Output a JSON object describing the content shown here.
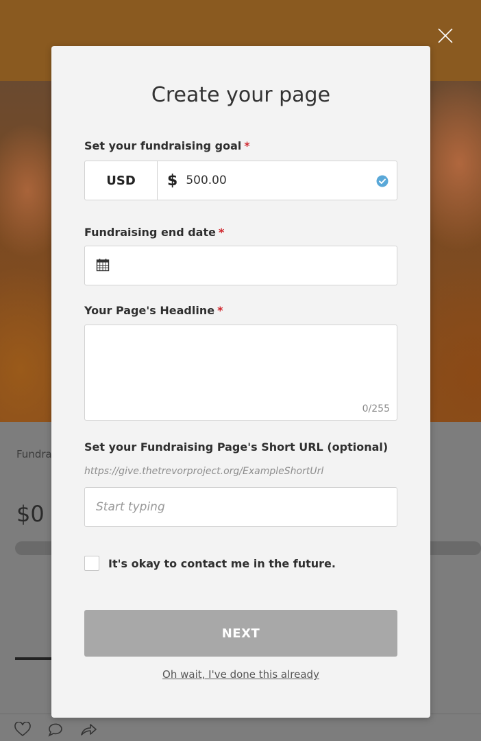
{
  "background": {
    "label": "Fundra",
    "amount": "$0"
  },
  "modal": {
    "title": "Create your page",
    "goal": {
      "label": "Set your fundraising goal",
      "required_mark": "*",
      "currency": "USD",
      "currency_symbol": "$",
      "amount": "500.00"
    },
    "end_date": {
      "label": "Fundraising end date",
      "required_mark": "*",
      "value": ""
    },
    "headline": {
      "label": "Your Page's Headline",
      "required_mark": "*",
      "value": "",
      "counter": "0/255"
    },
    "short_url": {
      "label": "Set your Fundraising Page's Short URL (optional)",
      "hint": "https://give.thetrevorproject.org/ExampleShortUrl",
      "placeholder": "Start typing"
    },
    "contact": {
      "label": "It's okay to contact me in the future.",
      "checked": false
    },
    "next_label": "NEXT",
    "done_link": "Oh wait, I've done this already"
  },
  "colors": {
    "required": "#d0262d",
    "button_disabled": "#a8a8a8",
    "check_accent": "#5aa8d8"
  }
}
